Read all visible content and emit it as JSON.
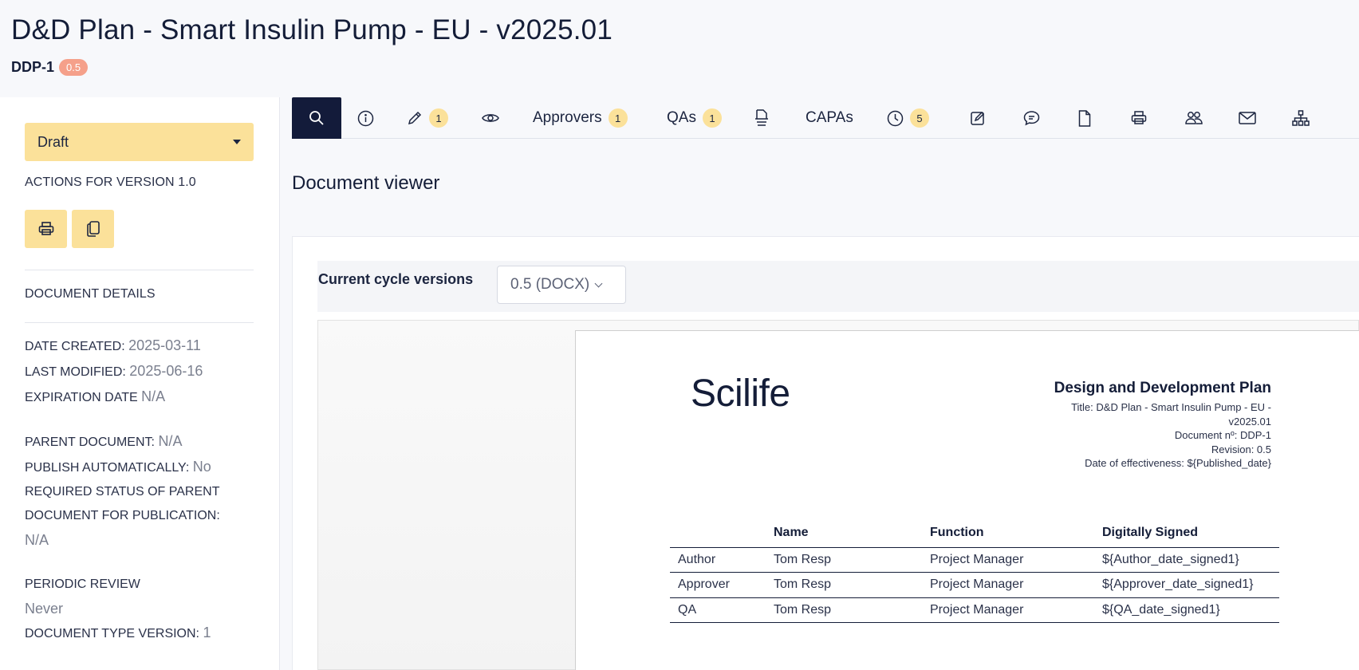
{
  "header": {
    "title": "D&D Plan - Smart Insulin Pump - EU - v2025.01",
    "doc_id": "DDP-1",
    "version_badge": "0.5"
  },
  "sidebar": {
    "status": "Draft",
    "actions_label": "ACTIONS FOR VERSION 1.0",
    "details_label": "DOCUMENT DETAILS",
    "date_created_label": "DATE CREATED:",
    "date_created": "2025-03-11",
    "last_modified_label": "LAST MODIFIED:",
    "last_modified": "2025-06-16",
    "expiration_label": "EXPIRATION DATE",
    "expiration": "N/A",
    "parent_label": "PARENT DOCUMENT:",
    "parent": "N/A",
    "publish_label": "PUBLISH AUTOMATICALLY:",
    "publish": "No",
    "required_status_label_1": "REQUIRED STATUS OF PARENT",
    "required_status_label_2": "DOCUMENT FOR PUBLICATION:",
    "required_status": "N/A",
    "periodic_label": "PERIODIC REVIEW",
    "periodic": "Never",
    "doctype_label": "DOCUMENT TYPE VERSION:",
    "doctype": "1"
  },
  "tabs": {
    "edit_count": "1",
    "approvers": "Approvers",
    "approvers_count": "1",
    "qas": "QAs",
    "qas_count": "1",
    "capas": "CAPAs",
    "history_count": "5"
  },
  "viewer": {
    "title": "Document viewer",
    "cycle_label": "Current cycle versions",
    "cycle_value": "0.5 (DOCX)"
  },
  "document": {
    "logo": "Scilife",
    "heading": "Design and Development Plan",
    "meta_1": "Title: D&D Plan - Smart Insulin Pump - EU -",
    "meta_2": "v2025.01",
    "meta_3": "Document nº: DDP-1",
    "meta_4": "Revision: 0.5",
    "meta_5": "Date of effectiveness: ${Published_date}",
    "table_headers": [
      "",
      "Name",
      "Function",
      "Digitally Signed"
    ],
    "table_rows": [
      [
        "Author",
        "Tom Resp",
        "Project Manager",
        "${Author_date_signed1}"
      ],
      [
        "Approver",
        "Tom Resp",
        "Project Manager",
        "${Approver_date_signed1}"
      ],
      [
        "QA",
        "Tom Resp",
        "Project Manager",
        "${QA_date_signed1}"
      ]
    ]
  },
  "colors": {
    "accent_dark": "#131b3a",
    "highlight_yellow": "#fbe19a",
    "badge_salmon": "#f5a08a"
  }
}
